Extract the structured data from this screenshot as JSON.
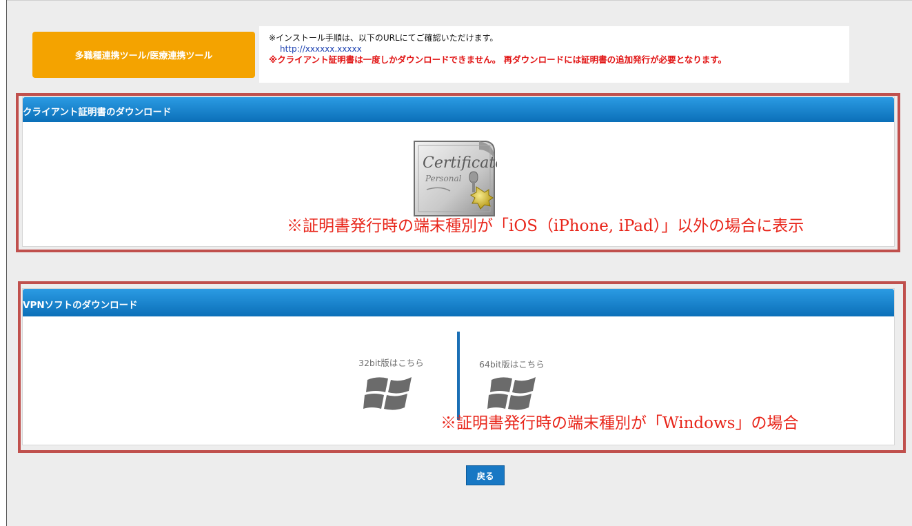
{
  "tool_badge": {
    "label": "多職種連携ツール/医療連携ツール"
  },
  "notice": {
    "line1": "※インストール手順は、以下のURLにてご確認いただけます。",
    "url": "http://xxxxxx.xxxxx",
    "warning": "※クライアント証明書は一度しかダウンロードできません。 再ダウンロードには証明書の追加発行が必要となります。"
  },
  "certificate_section": {
    "title": "クライアント証明書のダウンロード",
    "icon": "certificate-icon",
    "annotation": "※証明書発行時の端末種別が「iOS（iPhone, iPad）」以外の場合に表示"
  },
  "vpn_section": {
    "title": "VPNソフトのダウンロード",
    "download_32": {
      "label": "32bit版はこちら",
      "icon": "windows-icon"
    },
    "download_64": {
      "label": "64bit版はこちら",
      "icon": "windows-icon"
    },
    "annotation": "※証明書発行時の端末種別が「Windows」の場合"
  },
  "back_button": {
    "label": "戻る"
  },
  "colors": {
    "badge": "#f4a300",
    "header": "#1a84cf",
    "warning_text": "#e11414",
    "annotation": "#e8251a",
    "outline": "#c0504d",
    "button": "#1878c4"
  }
}
